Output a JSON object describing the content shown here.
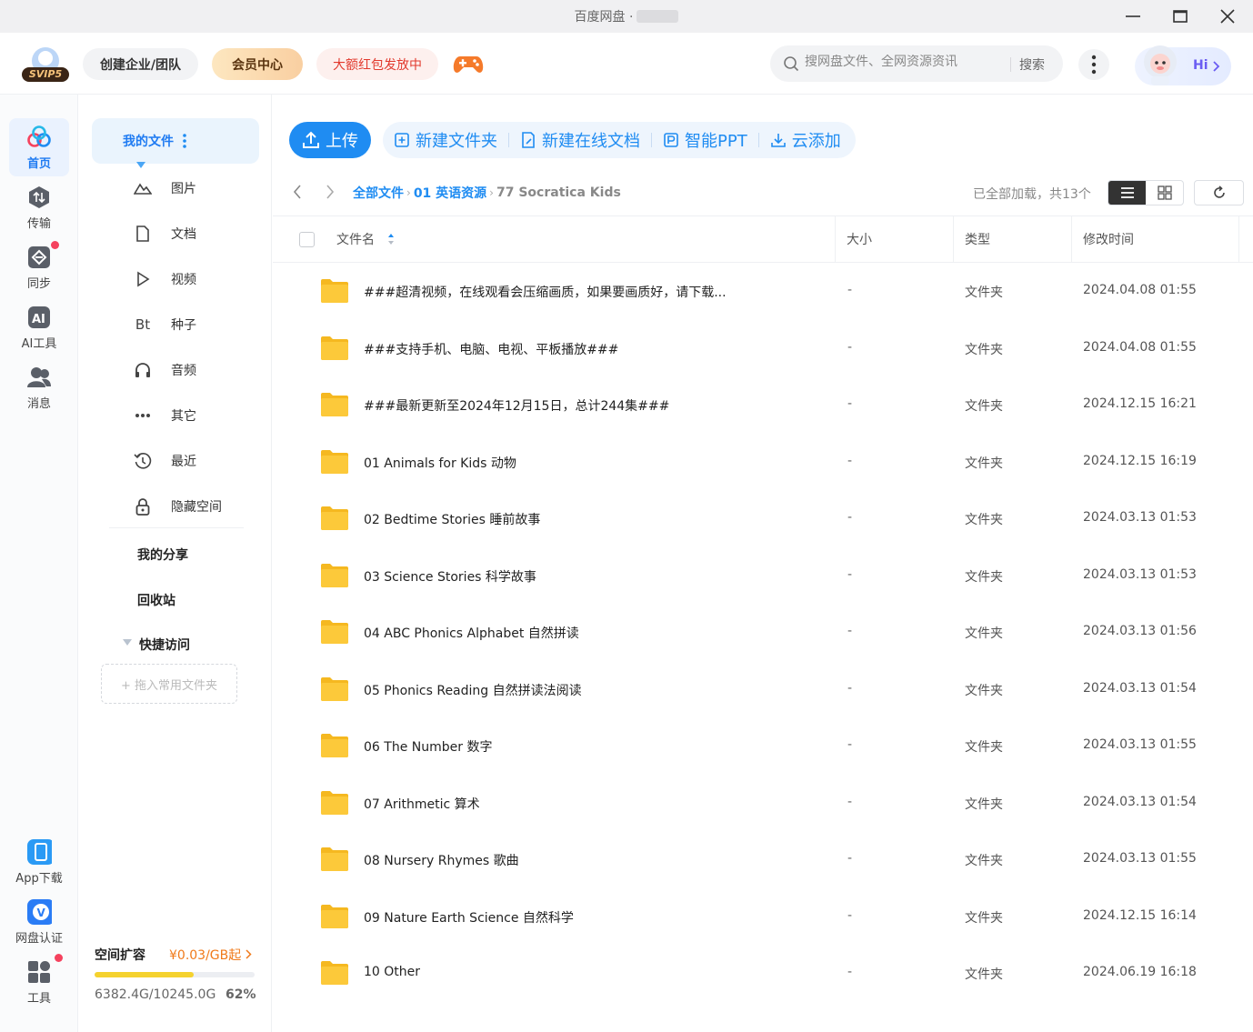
{
  "window": {
    "title": "百度网盘 ·"
  },
  "header": {
    "logo_text": "SVIP5",
    "create_team": "创建企业/团队",
    "member_center": "会员中心",
    "red_packet": "大额红包发放中",
    "search_placeholder": "搜网盘文件、全网资源资讯",
    "search_button": "搜索",
    "hi": "Hi"
  },
  "rail": {
    "items": [
      {
        "label": "首页",
        "icon": "cloud-home-icon"
      },
      {
        "label": "传输",
        "icon": "transfer-icon"
      },
      {
        "label": "同步",
        "icon": "sync-icon"
      },
      {
        "label": "AI工具",
        "icon": "ai-icon"
      },
      {
        "label": "消息",
        "icon": "message-icon"
      }
    ],
    "bottom": [
      {
        "label": "App下载",
        "icon": "phone-icon"
      },
      {
        "label": "网盘认证",
        "icon": "verify-icon"
      },
      {
        "label": "工具",
        "icon": "tools-icon"
      }
    ]
  },
  "sidebar": {
    "my_files": "我的文件",
    "items": [
      {
        "label": "图片",
        "icon": "image-icon"
      },
      {
        "label": "文档",
        "icon": "document-icon"
      },
      {
        "label": "视频",
        "icon": "video-icon"
      },
      {
        "label": "种子",
        "icon": "bt-icon",
        "glyph": "Bt"
      },
      {
        "label": "音频",
        "icon": "headphone-icon"
      },
      {
        "label": "其它",
        "icon": "more-icon"
      },
      {
        "label": "最近",
        "icon": "history-icon"
      },
      {
        "label": "隐藏空间",
        "icon": "lock-icon"
      }
    ],
    "my_share": "我的分享",
    "recycle": "回收站",
    "quick_access": "快捷访问",
    "drop_hint": "+ 拖入常用文件夹",
    "quota": {
      "title": "空间扩容",
      "promo": "¥0.03/GB起",
      "usage": "6382.4G/10245.0G",
      "percent_label": "62%",
      "used_fraction": 0.62
    }
  },
  "toolbar": {
    "upload": "上传",
    "new_folder": "新建文件夹",
    "new_doc": "新建在线文档",
    "smart_ppt": "智能PPT",
    "cloud_add": "云添加"
  },
  "breadcrumb": {
    "items": [
      "全部文件",
      "01 英语资源",
      "77 Socratica Kids"
    ],
    "count_text": "已全部加载，共13个"
  },
  "table": {
    "headers": {
      "name": "文件名",
      "size": "大小",
      "type": "类型",
      "mtime": "修改时间"
    },
    "rows": [
      {
        "name": "###超清视频，在线观看会压缩画质，如果要画质好，请下载...",
        "size": "-",
        "type": "文件夹",
        "mtime": "2024.04.08 01:55"
      },
      {
        "name": "###支持手机、电脑、电视、平板播放###",
        "size": "-",
        "type": "文件夹",
        "mtime": "2024.04.08 01:55"
      },
      {
        "name": "###最新更新至2024年12月15日，总计244集###",
        "size": "-",
        "type": "文件夹",
        "mtime": "2024.12.15 16:21"
      },
      {
        "name": "01 Animals for Kids 动物",
        "size": "-",
        "type": "文件夹",
        "mtime": "2024.12.15 16:19"
      },
      {
        "name": "02 Bedtime Stories 睡前故事",
        "size": "-",
        "type": "文件夹",
        "mtime": "2024.03.13 01:53"
      },
      {
        "name": "03 Science Stories 科学故事",
        "size": "-",
        "type": "文件夹",
        "mtime": "2024.03.13 01:53"
      },
      {
        "name": "04 ABC Phonics Alphabet 自然拼读",
        "size": "-",
        "type": "文件夹",
        "mtime": "2024.03.13 01:56"
      },
      {
        "name": "05 Phonics Reading 自然拼读法阅读",
        "size": "-",
        "type": "文件夹",
        "mtime": "2024.03.13 01:54"
      },
      {
        "name": "06 The Number 数字",
        "size": "-",
        "type": "文件夹",
        "mtime": "2024.03.13 01:55"
      },
      {
        "name": "07 Arithmetic 算术",
        "size": "-",
        "type": "文件夹",
        "mtime": "2024.03.13 01:54"
      },
      {
        "name": "08 Nursery Rhymes 歌曲",
        "size": "-",
        "type": "文件夹",
        "mtime": "2024.03.13 01:55"
      },
      {
        "name": "09 Nature Earth Science 自然科学",
        "size": "-",
        "type": "文件夹",
        "mtime": "2024.12.15 16:14"
      },
      {
        "name": "10 Other",
        "size": "-",
        "type": "文件夹",
        "mtime": "2024.06.19 16:18"
      }
    ]
  },
  "colors": {
    "accent": "#1f8cf2",
    "folder": "#fcc93a",
    "progress": "#f5d22e",
    "badge": "#f5425e"
  }
}
